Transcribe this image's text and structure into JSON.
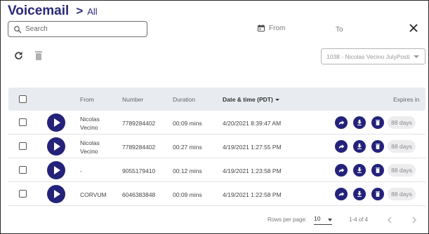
{
  "header": {
    "title": "Voicemail",
    "separator": ">",
    "crumb": "All"
  },
  "search": {
    "placeholder": "Search",
    "value": ""
  },
  "filters": {
    "from_label": "From",
    "to_label": "To"
  },
  "mailbox_select": {
    "value": "1038 - Nicolas Vecino JulyPosti"
  },
  "table": {
    "headers": {
      "from": "From",
      "number": "Number",
      "duration": "Duration",
      "datetime": "Date & time (PDT)",
      "expires": "Expires in"
    },
    "rows": [
      {
        "from_line1": "Nicolas",
        "from_line2": "Vecino",
        "number": "7789284402",
        "duration": "00:09 mins",
        "datetime": "4/20/2021 8:39:47 AM",
        "expires": "88 days"
      },
      {
        "from_line1": "Nicolas",
        "from_line2": "Vecino",
        "number": "7789284402",
        "duration": "00:27 mins",
        "datetime": "4/19/2021 1:27:55 PM",
        "expires": "88 days"
      },
      {
        "from_line1": "-",
        "from_line2": "",
        "number": "9055179410",
        "duration": "00:12 mins",
        "datetime": "4/19/2021 1:23:58 PM",
        "expires": "88 days"
      },
      {
        "from_line1": "CORVUM",
        "from_line2": "",
        "number": "6046383848",
        "duration": "00:09 mins",
        "datetime": "4/19/2021 1:22:58 PM",
        "expires": "88 days"
      }
    ]
  },
  "pagination": {
    "rows_per_page_label": "Rows per page:",
    "rows_per_page": "10",
    "range": "1-4 of 4"
  },
  "colors": {
    "accent": "#24227a",
    "title": "#2a2a7a",
    "header_bg": "#e8ebef"
  }
}
